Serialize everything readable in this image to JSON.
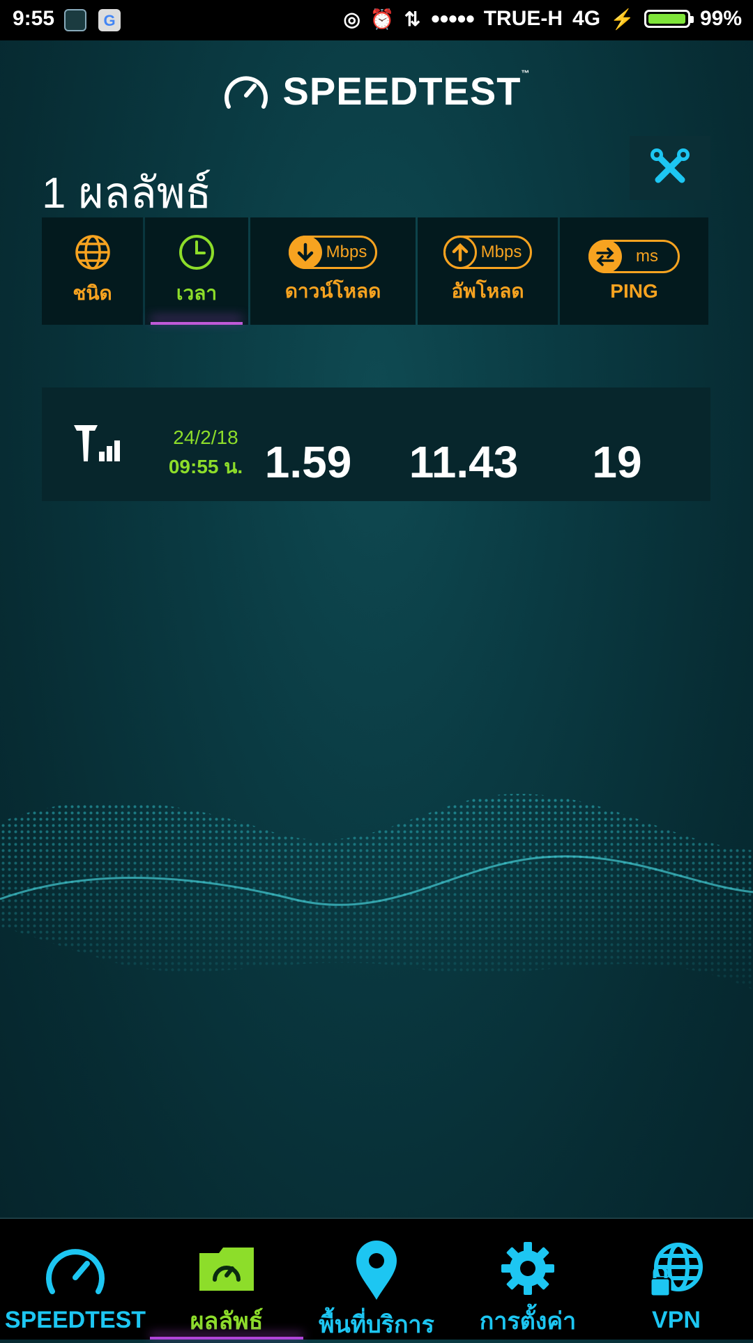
{
  "status_bar": {
    "time": "9:55",
    "carrier": "TRUE-H",
    "network": "4G",
    "battery": "99%",
    "battery_level": 0.99,
    "signal_dots": "●●●●●"
  },
  "header": {
    "app_title": "SPEEDTEST",
    "trademark": "™"
  },
  "results": {
    "count": "1",
    "title": "ผลลัพธ์"
  },
  "columns": [
    {
      "label": "ชนิด",
      "icon": "globe-icon"
    },
    {
      "label": "เวลา",
      "icon": "clock-icon"
    },
    {
      "label": "ดาวน์โหลด",
      "unit": "Mbps",
      "icon": "download-arrow-icon"
    },
    {
      "label": "อัพโหลด",
      "unit": "Mbps",
      "icon": "upload-arrow-icon"
    },
    {
      "label": "PING",
      "unit": "ms",
      "icon": "ping-arrows-icon"
    }
  ],
  "rows": [
    {
      "type_icon": "cellular-signal-icon",
      "date": "24/2/18",
      "time": "09:55 น.",
      "download": "1.59",
      "upload": "11.43",
      "ping": "19"
    }
  ],
  "nav": [
    {
      "label": "SPEEDTEST",
      "icon": "speedometer-icon"
    },
    {
      "label": "ผลลัพธ์",
      "icon": "results-folder-icon",
      "active": true
    },
    {
      "label": "พื้นที่บริการ",
      "icon": "map-pin-icon"
    },
    {
      "label": "การตั้งค่า",
      "icon": "gear-icon"
    },
    {
      "label": "VPN",
      "icon": "vpn-globe-lock-icon"
    }
  ],
  "colors": {
    "accent_orange": "#f7a320",
    "accent_green": "#8ddd2a",
    "accent_cyan": "#1dc6f2",
    "active_purple": "#c05ad8"
  }
}
